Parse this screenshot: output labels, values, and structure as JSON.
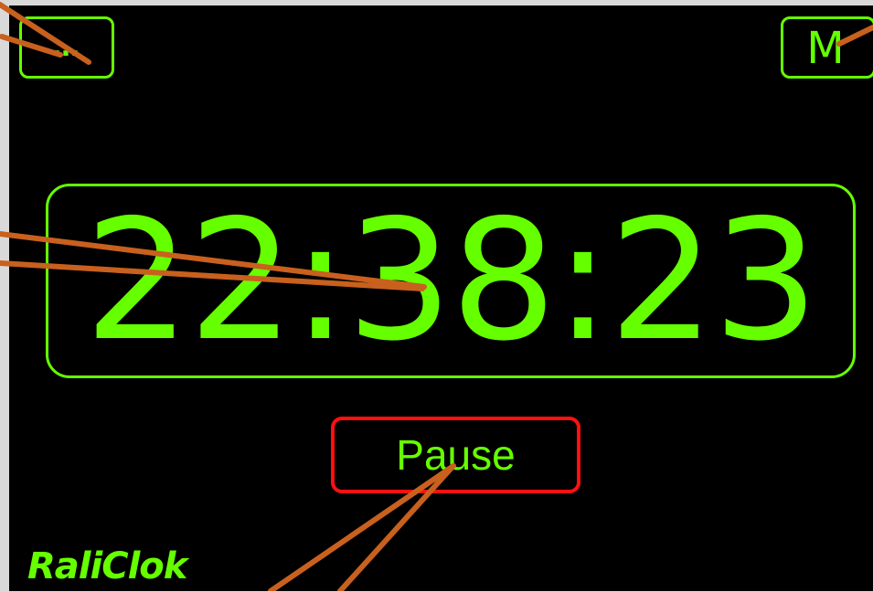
{
  "app": {
    "brand": "RaliClok",
    "menu_label": "…",
    "mode_label": "M",
    "time": "22:38:23",
    "pause_label": "Pause"
  },
  "colors": {
    "background": "#000000",
    "accent": "#66ff00",
    "pause_border": "#ff1010",
    "annotation": "#c8601e"
  }
}
